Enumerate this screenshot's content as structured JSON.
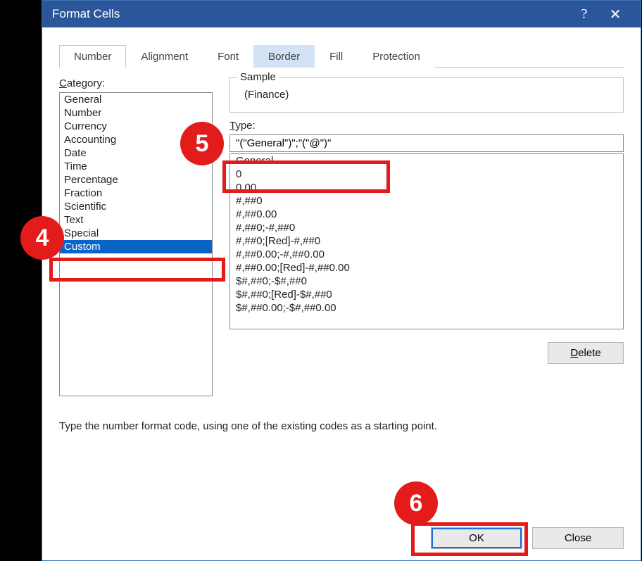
{
  "dialog": {
    "title": "Format Cells",
    "help": "?",
    "close": "✕"
  },
  "tabs": {
    "number": "Number",
    "alignment": "Alignment",
    "font": "Font",
    "border": "Border",
    "fill": "Fill",
    "protection": "Protection"
  },
  "labels": {
    "category": "Category:",
    "sample": "Sample",
    "type": "Type:",
    "delete": "Delete",
    "hint": "Type the number format code, using one of the existing codes as a starting point.",
    "ok": "OK",
    "close": "Close"
  },
  "sample_value": "(Finance)",
  "type_value": "\"(\"General\")\";\"(\"@\")\"",
  "categories": [
    "General",
    "Number",
    "Currency",
    "Accounting",
    "Date",
    "Time",
    "Percentage",
    "Fraction",
    "Scientific",
    "Text",
    "Special",
    "Custom"
  ],
  "selected_category_index": 11,
  "formats": [
    "General",
    "0",
    "0.00",
    "#,##0",
    "#,##0.00",
    "#,##0;-#,##0",
    "#,##0;[Red]-#,##0",
    "#,##0.00;-#,##0.00",
    "#,##0.00;[Red]-#,##0.00",
    "$#,##0;-$#,##0",
    "$#,##0;[Red]-$#,##0",
    "$#,##0.00;-$#,##0.00"
  ],
  "callouts": {
    "c4": "4",
    "c5": "5",
    "c6": "6"
  }
}
